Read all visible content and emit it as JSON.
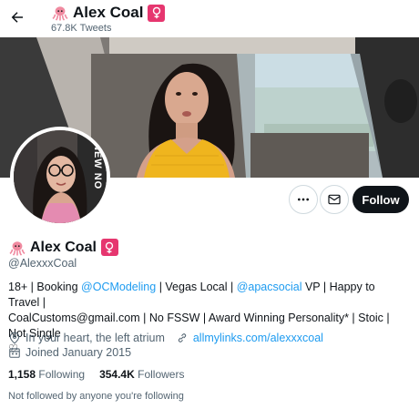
{
  "header": {
    "display_name": "Alex Coal",
    "tweet_count": "67.8K Tweets"
  },
  "profile": {
    "display_name": "Alex Coal",
    "handle": "@AlexxxCoal",
    "bio": {
      "t1": "18+ | Booking ",
      "mention1": "@OCModeling",
      "t2": " | Vegas Local | ",
      "mention2": "@apacsocial",
      "t3": " VP | Happy to Travel |",
      "t4": "CoalCustoms@gmail.com | No FSSW | Award Winning Personality* | Stoic | Not Single",
      "heart": "♡"
    },
    "location": "In your heart, the left atrium",
    "website": "allmylinks.com/alexxxcoal",
    "joined": "Joined January 2015",
    "following_count": "1,158",
    "following_label": "Following",
    "followers_count": "354.4K",
    "followers_label": "Followers",
    "followed_note": "Not followed by anyone you're following",
    "avatar_text": "NEW NO"
  },
  "actions": {
    "follow_label": "Follow"
  },
  "icons": {
    "back": "arrow-left-icon",
    "more": "ellipsis-icon",
    "message": "envelope-icon",
    "location": "location-pin-icon",
    "link": "link-icon",
    "calendar": "calendar-icon",
    "octopus": "octopus-emoji",
    "female": "female-sign-emoji"
  },
  "colors": {
    "accent": "#1d9bf0",
    "text": "#0f1419",
    "muted": "#536471",
    "female_badge": "#e6366f",
    "octopus": "#f08aa0"
  }
}
